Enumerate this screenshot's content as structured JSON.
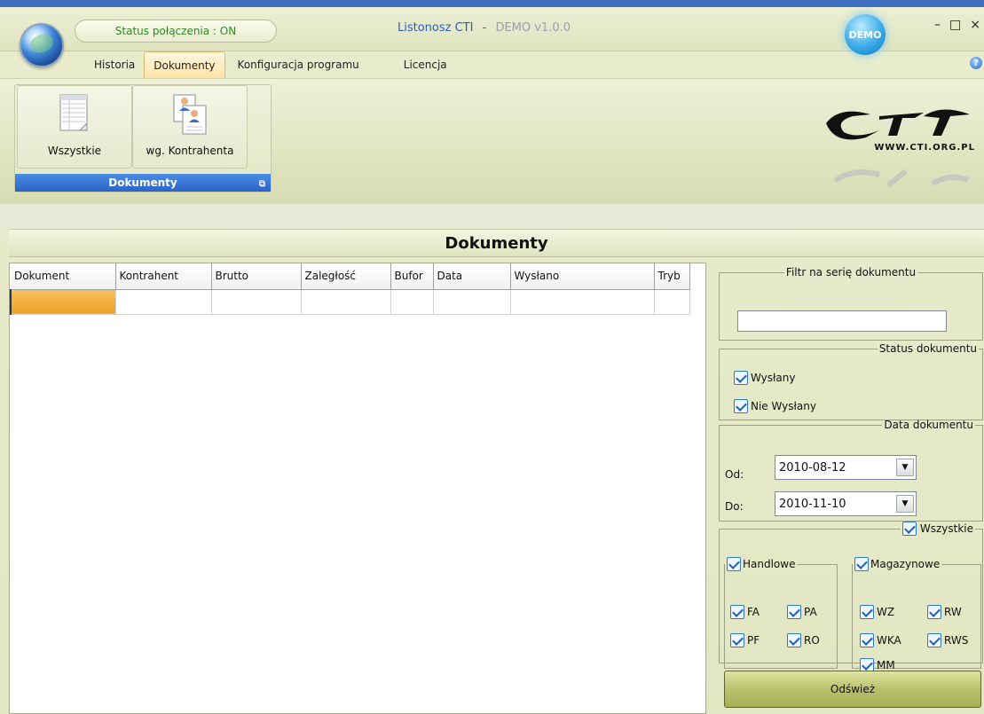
{
  "window": {
    "status": "Status połączenia : ON",
    "title": "Listonosz CTI",
    "title_separator": "-",
    "version": "DEMO v1.0.0",
    "badge": "DEMO",
    "controls": [
      "–",
      "□",
      "×"
    ]
  },
  "menu": {
    "tabs": [
      {
        "label": "Historia",
        "active": false
      },
      {
        "label": "Dokumenty",
        "active": true
      },
      {
        "label": "Konfiguracja programu",
        "active": false
      },
      {
        "label": "Licencja",
        "active": false
      }
    ],
    "help_icon": "?"
  },
  "ribbon": {
    "buttons": [
      {
        "label": "Wszystkie",
        "icon": "document-list-icon"
      },
      {
        "label": "wg. Kontrahenta",
        "icon": "contacts-document-icon"
      }
    ],
    "group_caption": "Dokumenty",
    "launcher_icon": "⧉",
    "logo_url": "WWW.CTI.ORG.PL"
  },
  "section": {
    "title": "Dokumenty"
  },
  "grid": {
    "columns": [
      "Dokument",
      "Kontrahent",
      "Brutto",
      "Zaległość",
      "Bufor",
      "Data",
      "Wysłano",
      "Tryb"
    ],
    "rows": [
      [
        "",
        "",
        "",
        "",
        "",
        "",
        "",
        ""
      ]
    ]
  },
  "panel": {
    "filter": {
      "legend": "Filtr na serię dokumentu",
      "value": ""
    },
    "status": {
      "legend": "Status dokumentu",
      "options": [
        {
          "label": "Wysłany",
          "checked": true
        },
        {
          "label": "Nie Wysłany",
          "checked": true
        }
      ]
    },
    "date": {
      "legend": "Data dokumentu",
      "from_label": "Od:",
      "from_value": "2010-08-12",
      "to_label": "Do:",
      "to_value": "2010-11-10"
    },
    "all": {
      "legend": "Wszystkie",
      "checked": true,
      "handlowe": {
        "legend": "Handlowe",
        "items": [
          "FA",
          "PA",
          "PF",
          "RO"
        ]
      },
      "magazynowe": {
        "legend": "Magazynowe",
        "items": [
          "WZ",
          "RW",
          "WKA",
          "RWS",
          "MM"
        ]
      }
    },
    "refresh_label": "Odśwież"
  }
}
